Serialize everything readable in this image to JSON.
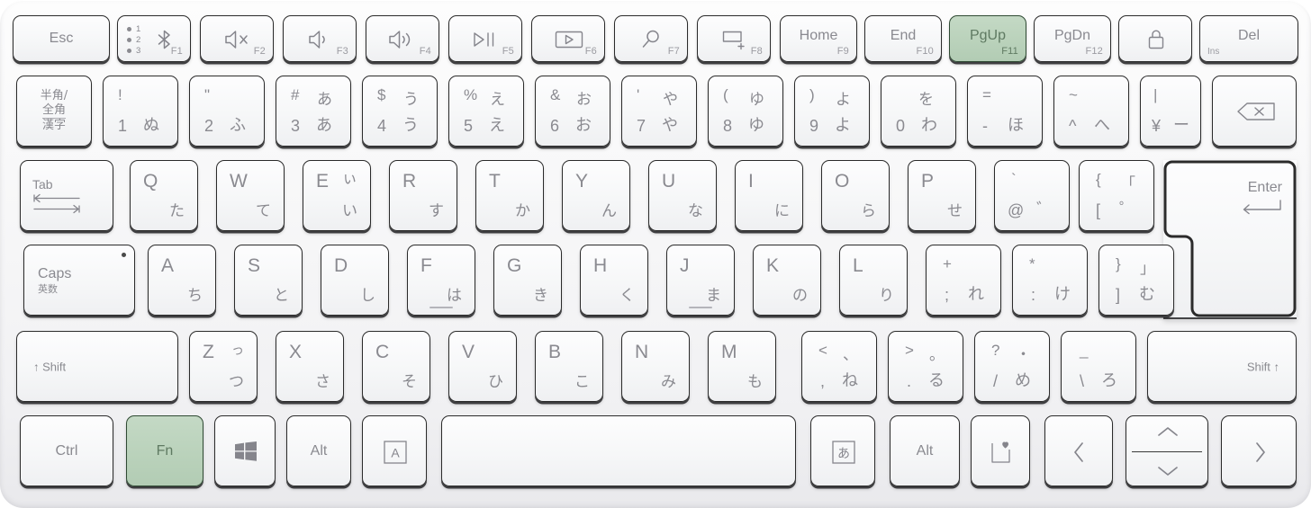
{
  "device": {
    "name": "wireless-compact-keyboard",
    "layout": "Japanese JIS",
    "body_color": "#f5f5f7",
    "key_color": "#f7f8f9",
    "key_border_color": "#2b2b2b",
    "legend_color": "#8a8a90",
    "highlight_color": "#bad2bb",
    "highlight_border_color": "#2f4a33",
    "highlighted_keys": [
      "PgUp",
      "Fn"
    ]
  },
  "rows": {
    "function_row": [
      {
        "name": "esc",
        "main": "Esc"
      },
      {
        "name": "bluetooth",
        "main": "",
        "icon": "bluetooth-icon",
        "channels": [
          "1",
          "2",
          "3"
        ],
        "fn": "F1"
      },
      {
        "name": "mute",
        "main": "",
        "icon": "speaker-mute-icon",
        "fn": "F2"
      },
      {
        "name": "volume-down",
        "main": "",
        "icon": "speaker-low-icon",
        "fn": "F3"
      },
      {
        "name": "volume-up",
        "main": "",
        "icon": "speaker-high-icon",
        "fn": "F4"
      },
      {
        "name": "play-pause",
        "main": "",
        "icon": "play-pause-icon",
        "fn": "F5"
      },
      {
        "name": "project",
        "main": "",
        "icon": "screen-play-icon",
        "fn": "F6"
      },
      {
        "name": "search",
        "main": "",
        "icon": "magnifier-icon",
        "fn": "F7"
      },
      {
        "name": "new-desktop",
        "main": "",
        "icon": "new-window-icon",
        "fn": "F8"
      },
      {
        "name": "home",
        "main": "Home",
        "fn": "F9"
      },
      {
        "name": "end",
        "main": "End",
        "fn": "F10"
      },
      {
        "name": "pgup",
        "main": "PgUp",
        "fn": "F11",
        "highlighted": true
      },
      {
        "name": "pgdn",
        "main": "PgDn",
        "fn": "F12"
      },
      {
        "name": "lock",
        "main": "",
        "icon": "padlock-icon"
      },
      {
        "name": "delete",
        "main": "Del",
        "sub": "Ins"
      }
    ],
    "number_row": [
      {
        "name": "hankaku-zenkaku",
        "lines": [
          "半角/",
          "全角",
          "漢字"
        ]
      },
      {
        "name": "digit-1",
        "tl": "!",
        "tr": "",
        "bl": "1",
        "br": "ぬ"
      },
      {
        "name": "digit-2",
        "tl": "\"",
        "tr": "",
        "bl": "2",
        "br": "ふ"
      },
      {
        "name": "digit-3",
        "tl": "#",
        "tr": "あ",
        "bl": "3",
        "br": "あ"
      },
      {
        "name": "digit-4",
        "tl": "$",
        "tr": "う",
        "bl": "4",
        "br": "う"
      },
      {
        "name": "digit-5",
        "tl": "%",
        "tr": "え",
        "bl": "5",
        "br": "え"
      },
      {
        "name": "digit-6",
        "tl": "&",
        "tr": "お",
        "bl": "6",
        "br": "お"
      },
      {
        "name": "digit-7",
        "tl": "'",
        "tr": "や",
        "bl": "7",
        "br": "や"
      },
      {
        "name": "digit-8",
        "tl": "(",
        "tr": "ゆ",
        "bl": "8",
        "br": "ゆ"
      },
      {
        "name": "digit-9",
        "tl": ")",
        "tr": "よ",
        "bl": "9",
        "br": "よ"
      },
      {
        "name": "digit-0",
        "tl": "",
        "tr": "を",
        "bl": "0",
        "br": "わ"
      },
      {
        "name": "minus",
        "tl": "=",
        "tr": "",
        "bl": "-",
        "br": "ほ"
      },
      {
        "name": "caret",
        "tl": "~",
        "tr": "",
        "bl": "^",
        "br": "へ"
      },
      {
        "name": "yen",
        "tl": "|",
        "tr": "",
        "bl": "¥",
        "br": "ー"
      },
      {
        "name": "backspace",
        "icon": "backspace-icon"
      }
    ],
    "qwerty_row": [
      {
        "name": "tab",
        "main": "Tab",
        "icon": "tab-arrows-icon"
      },
      {
        "name": "q",
        "alpha": "Q",
        "kana": "た"
      },
      {
        "name": "w",
        "alpha": "W",
        "kana": "て"
      },
      {
        "name": "e",
        "alpha": "E",
        "kana": "い",
        "kana_top": "ぃ"
      },
      {
        "name": "r",
        "alpha": "R",
        "kana": "す"
      },
      {
        "name": "t",
        "alpha": "T",
        "kana": "か"
      },
      {
        "name": "y",
        "alpha": "Y",
        "kana": "ん"
      },
      {
        "name": "u",
        "alpha": "U",
        "kana": "な"
      },
      {
        "name": "i",
        "alpha": "I",
        "kana": "に"
      },
      {
        "name": "o",
        "alpha": "O",
        "kana": "ら"
      },
      {
        "name": "p",
        "alpha": "P",
        "kana": "せ"
      },
      {
        "name": "at",
        "tl": "`",
        "bl": "@",
        "br": "゛"
      },
      {
        "name": "bracket-left",
        "tl": "{",
        "tr": "「",
        "bl": "[",
        "br": "゜"
      },
      {
        "name": "enter",
        "main": "Enter",
        "icon": "enter-arrow-icon"
      }
    ],
    "home_row": [
      {
        "name": "capslock",
        "main": "Caps",
        "sub": "英数",
        "led": true
      },
      {
        "name": "a",
        "alpha": "A",
        "kana": "ち"
      },
      {
        "name": "s",
        "alpha": "S",
        "kana": "と"
      },
      {
        "name": "d",
        "alpha": "D",
        "kana": "し"
      },
      {
        "name": "f",
        "alpha": "F",
        "kana": "は",
        "homing": true
      },
      {
        "name": "g",
        "alpha": "G",
        "kana": "き"
      },
      {
        "name": "h",
        "alpha": "H",
        "kana": "く"
      },
      {
        "name": "j",
        "alpha": "J",
        "kana": "ま",
        "homing": true
      },
      {
        "name": "k",
        "alpha": "K",
        "kana": "の"
      },
      {
        "name": "l",
        "alpha": "L",
        "kana": "り"
      },
      {
        "name": "semicolon",
        "tl": "+",
        "bl": ";",
        "br": "れ"
      },
      {
        "name": "colon",
        "tl": "*",
        "bl": ":",
        "br": "け"
      },
      {
        "name": "bracket-right",
        "tl": "}",
        "tr": "」",
        "bl": "]",
        "br": "む"
      }
    ],
    "shift_row": [
      {
        "name": "shift-left",
        "main": "↑ Shift"
      },
      {
        "name": "z",
        "alpha": "Z",
        "kana": "つ",
        "kana_top": "っ"
      },
      {
        "name": "x",
        "alpha": "X",
        "kana": "さ"
      },
      {
        "name": "c",
        "alpha": "C",
        "kana": "そ"
      },
      {
        "name": "v",
        "alpha": "V",
        "kana": "ひ"
      },
      {
        "name": "b",
        "alpha": "B",
        "kana": "こ"
      },
      {
        "name": "n",
        "alpha": "N",
        "kana": "み"
      },
      {
        "name": "m",
        "alpha": "M",
        "kana": "も"
      },
      {
        "name": "comma",
        "tl": "<",
        "tr": "、",
        "bl": ",",
        "br": "ね"
      },
      {
        "name": "period",
        "tl": ">",
        "tr": "。",
        "bl": ".",
        "br": "る"
      },
      {
        "name": "slash",
        "tl": "?",
        "tr": "・",
        "bl": "/",
        "br": "め"
      },
      {
        "name": "backslash",
        "tl": "_",
        "bl": "\\",
        "br": "ろ"
      },
      {
        "name": "shift-right",
        "main": "Shift ↑"
      }
    ],
    "modifier_row": [
      {
        "name": "ctrl",
        "main": "Ctrl"
      },
      {
        "name": "fn",
        "main": "Fn",
        "highlighted": true
      },
      {
        "name": "windows",
        "main": "",
        "icon": "windows-logo-icon"
      },
      {
        "name": "alt-left",
        "main": "Alt"
      },
      {
        "name": "muhenkan",
        "main": "A",
        "icon": "boxed-a-icon"
      },
      {
        "name": "space",
        "main": ""
      },
      {
        "name": "henkan",
        "main": "あ",
        "icon": "boxed-a-kana-icon"
      },
      {
        "name": "alt-right",
        "main": "Alt"
      },
      {
        "name": "favorites",
        "main": "",
        "icon": "heart-page-icon"
      },
      {
        "name": "arrow-left",
        "main": "",
        "icon": "chevron-left-icon"
      },
      {
        "name": "arrow-up-down",
        "main": "",
        "icon": "chevron-up-down-icon"
      },
      {
        "name": "arrow-right",
        "main": "",
        "icon": "chevron-right-icon"
      }
    ]
  }
}
